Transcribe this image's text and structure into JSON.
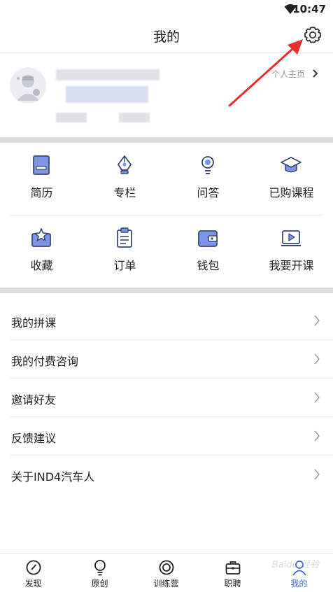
{
  "status_bar": {
    "time": "10:47",
    "wifi_icon": "wifi-icon"
  },
  "header": {
    "title": "我的",
    "settings_icon": "gear-icon"
  },
  "profile": {
    "homepage_link": "个人主页",
    "avatar_icon": "avatar-icon"
  },
  "grid": {
    "rows": [
      [
        {
          "label": "简历",
          "icon": "resume-icon"
        },
        {
          "label": "专栏",
          "icon": "pen-nib-icon"
        },
        {
          "label": "问答",
          "icon": "lightbulb-icon"
        },
        {
          "label": "已购课程",
          "icon": "graduation-cap-icon"
        }
      ],
      [
        {
          "label": "收藏",
          "icon": "star-box-icon"
        },
        {
          "label": "订单",
          "icon": "clipboard-icon"
        },
        {
          "label": "钱包",
          "icon": "wallet-icon"
        },
        {
          "label": "我要开课",
          "icon": "video-screen-icon"
        }
      ]
    ]
  },
  "menu": {
    "items": [
      {
        "label": "我的拼课"
      },
      {
        "label": "我的付费咨询"
      },
      {
        "label": "邀请好友"
      },
      {
        "label": "反馈建议"
      },
      {
        "label": "关于IND4汽车人"
      }
    ]
  },
  "tabbar": {
    "tabs": [
      {
        "label": "发现",
        "icon": "compass-icon"
      },
      {
        "label": "原创",
        "icon": "lightbulb-icon"
      },
      {
        "label": "训练营",
        "icon": "target-icon"
      },
      {
        "label": "职聘",
        "icon": "briefcase-icon"
      },
      {
        "label": "我的",
        "icon": "person-icon"
      }
    ],
    "active_index": 4
  },
  "watermark": "Baidu 经验",
  "colors": {
    "accent": "#3f6bdc",
    "icon_blue": "#7d94e8",
    "icon_stroke": "#3b4a6b",
    "annotation_red": "#e8302a"
  }
}
